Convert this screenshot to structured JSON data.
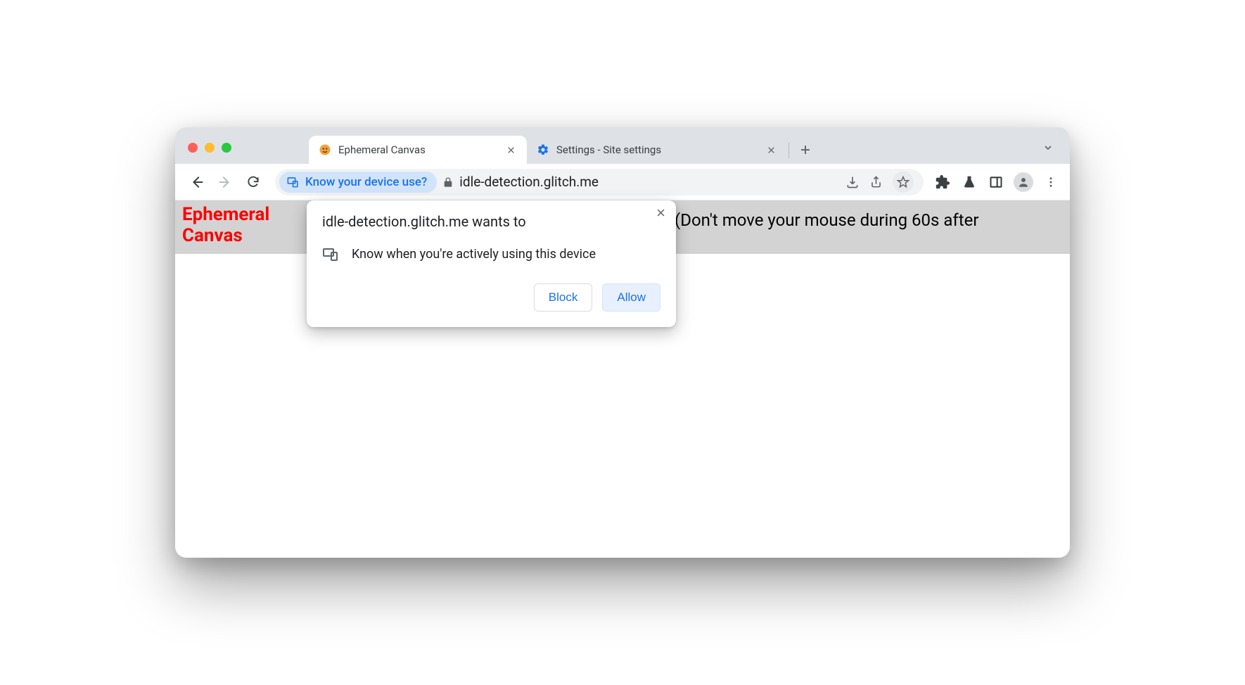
{
  "tabs": [
    {
      "title": "Ephemeral Canvas"
    },
    {
      "title": "Settings - Site settings"
    }
  ],
  "omnibox": {
    "chip": "Know your device use?",
    "url": "idle-detection.glitch.me"
  },
  "page": {
    "title_line1": "Ephemeral",
    "title_line2": "Canvas",
    "instruction": "(Don't move your mouse during 60s after"
  },
  "permission": {
    "title": "idle-detection.glitch.me wants to",
    "request": "Know when you're actively using this device",
    "block": "Block",
    "allow": "Allow"
  }
}
